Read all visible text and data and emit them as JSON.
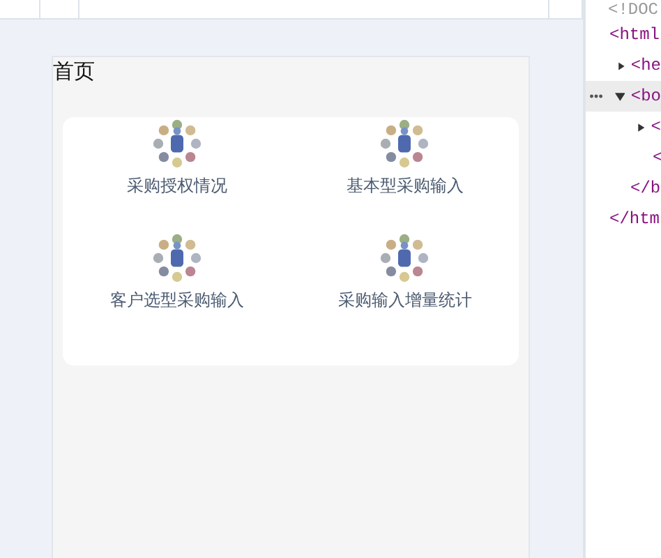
{
  "page": {
    "title": "首页"
  },
  "menu": [
    {
      "label": "采购授权情况"
    },
    {
      "label": "基本型采购输入"
    },
    {
      "label": "客户选型采购输入"
    },
    {
      "label": "采购输入增量统计"
    }
  ],
  "devtools": {
    "doctype": "<!DOC",
    "tree": [
      {
        "text": "<html",
        "kind": "root",
        "selected": false,
        "close": "</htm",
        "children": [
          {
            "text": "<he",
            "kind": "parent",
            "expanded": false,
            "selected": false
          },
          {
            "text": "<bo",
            "kind": "parent",
            "expanded": true,
            "selected": true,
            "close": "</b",
            "children": [
              {
                "text": "<",
                "kind": "parent",
                "expanded": false,
                "selected": false
              },
              {
                "text": "<",
                "kind": "leaf",
                "selected": false
              }
            ]
          }
        ]
      }
    ]
  }
}
